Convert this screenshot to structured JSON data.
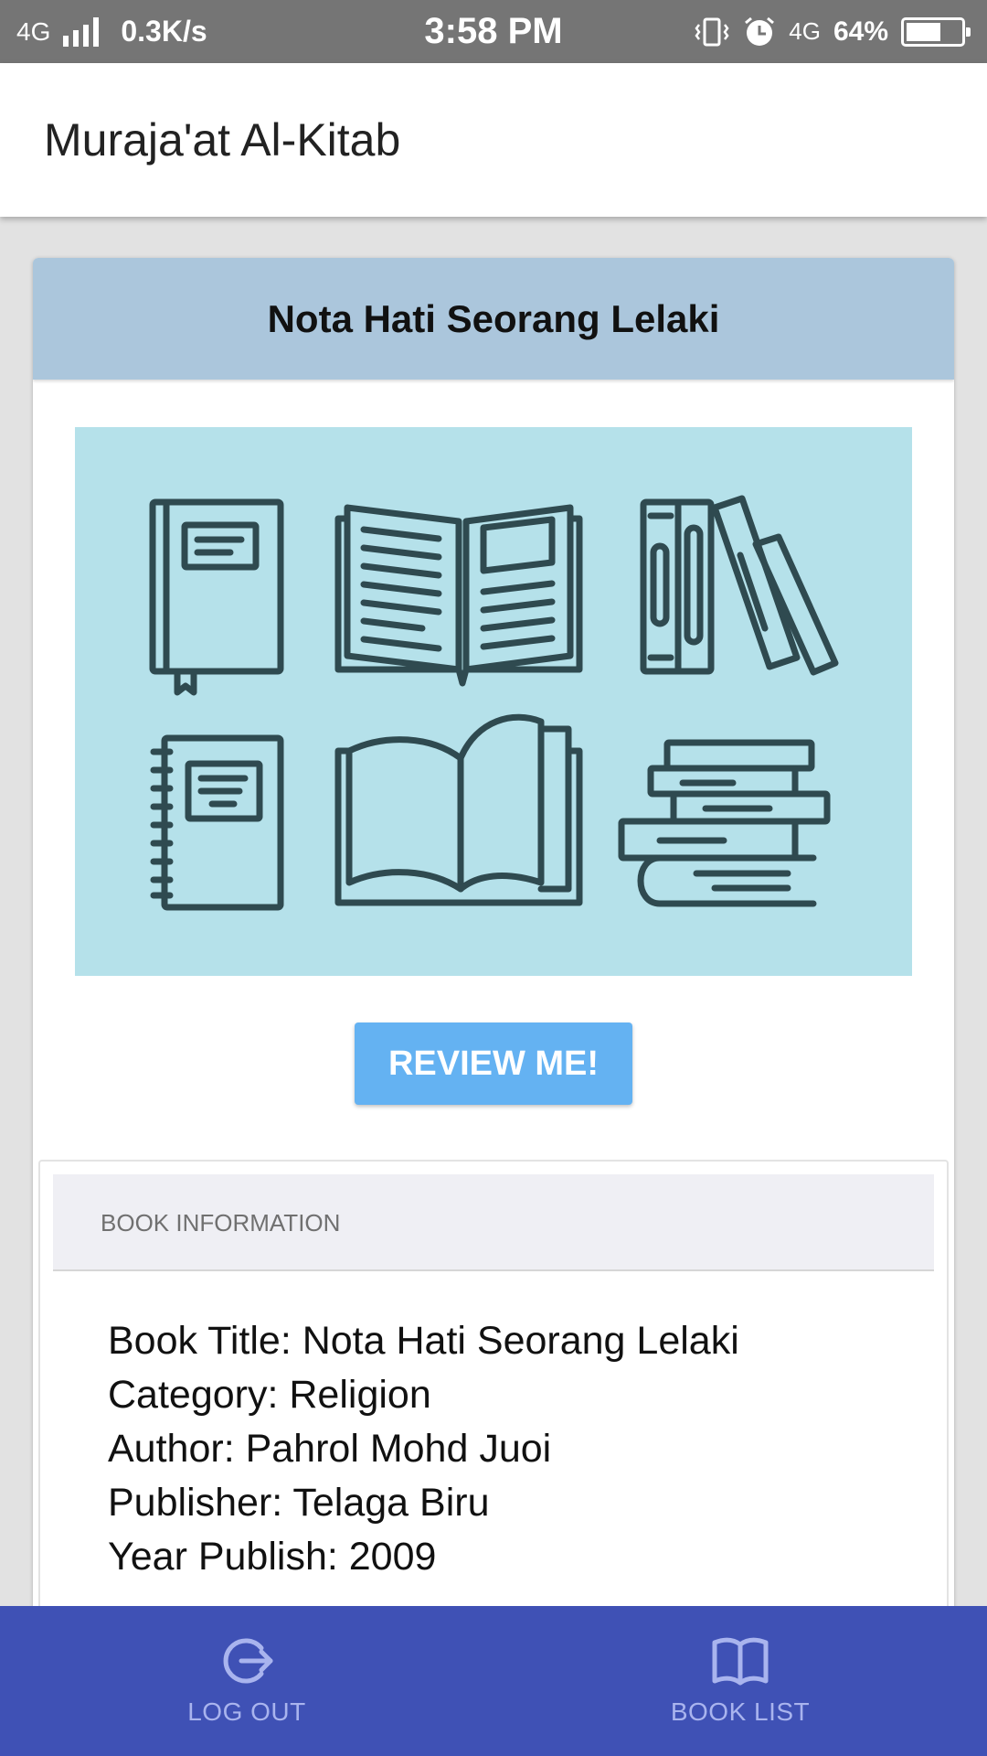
{
  "status_bar": {
    "network": "4G",
    "speed": "0.3K/s",
    "time": "3:58 PM",
    "network_secondary": "4G",
    "battery_percent": "64%",
    "battery_level": 0.64,
    "icons": [
      "signal-icon",
      "vibrate-icon",
      "alarm-icon",
      "battery-icon"
    ]
  },
  "app_bar": {
    "title": "Muraja'at Al-Kitab"
  },
  "book_card": {
    "title": "Nota Hati Seorang Lelaki",
    "image_icon": "books-illustration",
    "review_button": "REVIEW ME!"
  },
  "book_info": {
    "section_label": "BOOK INFORMATION",
    "lines": [
      "Book Title: Nota Hati Seorang Lelaki",
      "Category: Religion",
      "Author: Pahrol Mohd Juoi",
      "Publisher: Telaga Biru",
      "Year Publish: 2009"
    ]
  },
  "bottom_nav": {
    "items": [
      {
        "label": "LOG OUT",
        "icon": "logout-icon"
      },
      {
        "label": "BOOK LIST",
        "icon": "book-open-icon"
      }
    ]
  },
  "colors": {
    "status_bar": "#757575",
    "card_header": "#abc6dc",
    "illustration_bg": "#b5e1ea",
    "illustration_stroke": "#2f4a50",
    "review_button": "#64b2f2",
    "bottom_nav": "#3f51b5",
    "bottom_nav_text": "#a9b4ee"
  }
}
